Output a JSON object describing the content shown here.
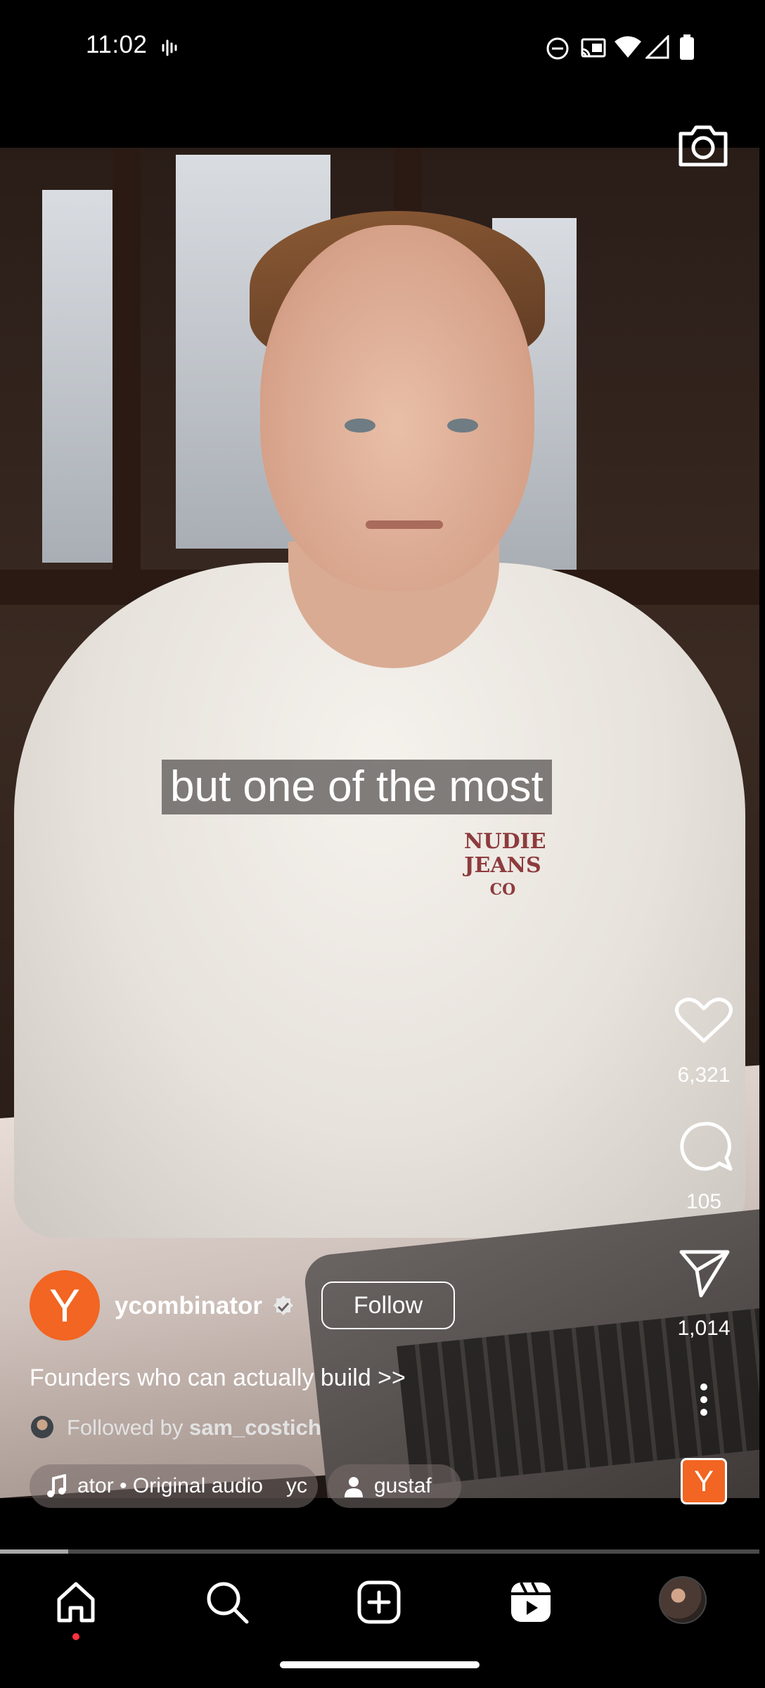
{
  "status_bar": {
    "time": "11:02",
    "icons": [
      "sound-wave-icon",
      "do-not-disturb-icon",
      "cast-icon",
      "wifi-icon",
      "cellular-signal-icon",
      "battery-icon"
    ]
  },
  "video": {
    "caption": "but one of the most",
    "shirt_text": [
      "NUDIE",
      "JEANS",
      "CO"
    ]
  },
  "actions": {
    "camera_icon": "camera-icon",
    "likes": "6,321",
    "comments": "105",
    "shares": "1,014",
    "more_icon": "more-vertical-icon"
  },
  "post": {
    "avatar_letter": "Y",
    "username": "ycombinator",
    "verified": true,
    "follow_label": "Follow",
    "description": "Founders who can actually build >>",
    "followed_by_prefix": "Followed by ",
    "followed_by_user": "sam_costich",
    "audio_chip": "ator • Original audio",
    "audio_chip_tail": "yc",
    "tagged_person": "gustaf",
    "audio_thumb_letter": "Y"
  },
  "progress": {
    "fraction": 0.09
  },
  "nav": {
    "items": [
      "home-icon",
      "search-icon",
      "create-icon",
      "reels-icon",
      "profile-avatar"
    ]
  },
  "colors": {
    "brand_orange": "#f26522",
    "notification_red": "#ff3040",
    "background": "#000000"
  }
}
